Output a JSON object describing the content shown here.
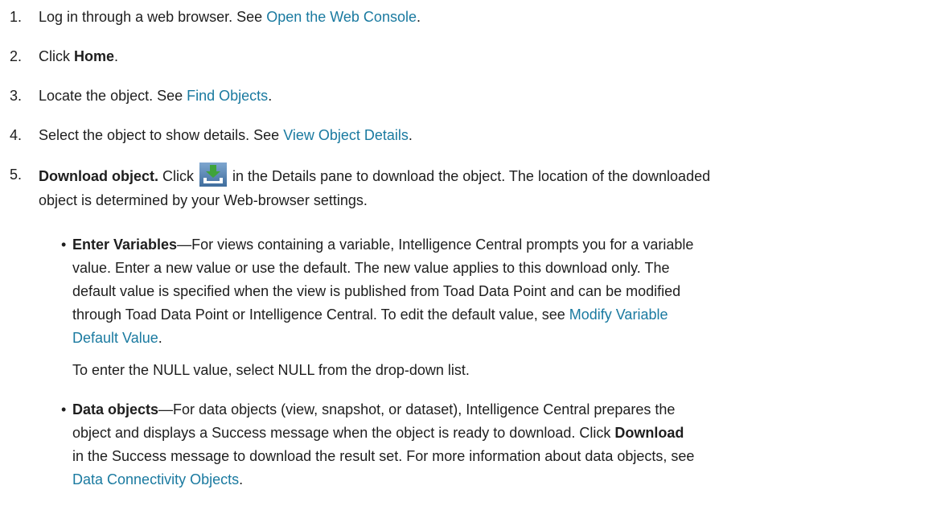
{
  "steps": [
    {
      "num": "1.",
      "text": "Log in through a web browser. See ",
      "link": "Open the Web Console",
      "after": "."
    },
    {
      "num": "2.",
      "text": "Click ",
      "bold": "Home",
      "after": "."
    },
    {
      "num": "3.",
      "text": "Locate the object. See ",
      "link": "Find Objects",
      "after": "."
    },
    {
      "num": "4.",
      "text": "Select the object to show details. See ",
      "link": "View Object Details",
      "after": "."
    }
  ],
  "step5": {
    "num": "5.",
    "bold": "Download object.",
    "pre": " Click ",
    "icon": "download-icon",
    "post_line1": " in the Details pane to download the object. The location of the downloaded",
    "line2": "object is determined by your Web-browser settings."
  },
  "bullet1": {
    "bold": "Enter Variables",
    "line1": "—For views containing a variable, Intelligence Central prompts you for a variable",
    "line2": "value. Enter a new value or use the default. The new value applies to this download only. The",
    "line3": "default value is specified when the view is published from Toad Data Point and can be modified",
    "line4_pre": "through Toad Data Point or Intelligence Central. To edit the default value, see ",
    "link_part1": "Modify Variable",
    "link_part2": "Default Value",
    "after": "."
  },
  "null_note": "To enter the NULL value, select NULL from the drop-down list.",
  "bullet2": {
    "bold": "Data objects",
    "line1": "—For data objects (view, snapshot, or dataset), Intelligence Central prepares the",
    "line2": "object and displays a Success message when the object is ready to download. Click ",
    "bold2": "Download",
    "line3": "in the Success message to download the result set. For more information about data objects, see",
    "link": "Data Connectivity Objects",
    "after": "."
  },
  "colors": {
    "link": "#1a7aa0",
    "text": "#1e1e1e",
    "icon_bg": "#5a86b4"
  }
}
